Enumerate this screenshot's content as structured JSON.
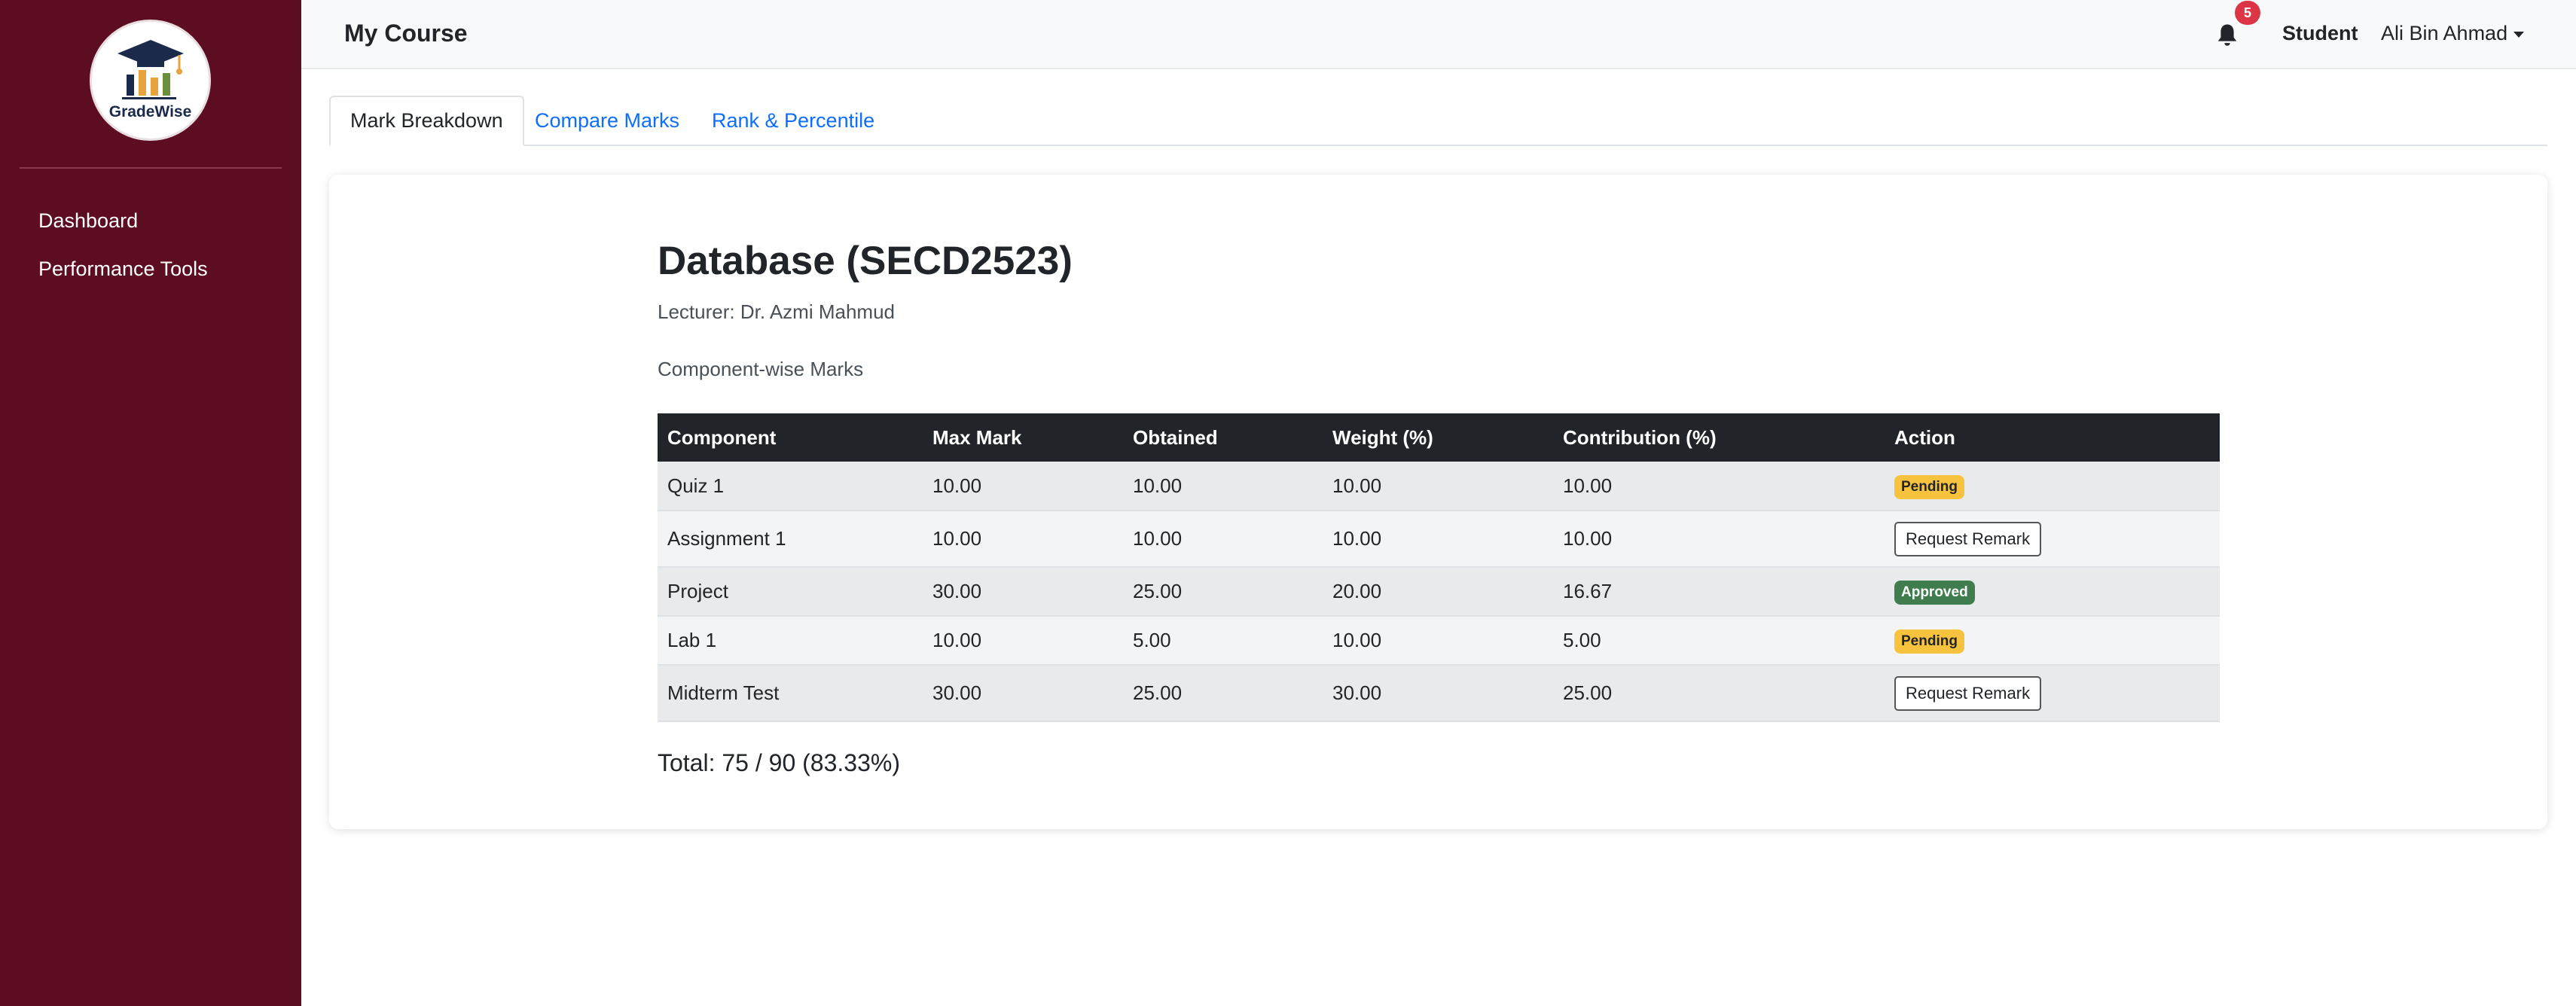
{
  "brand": {
    "logo_text": "GradeWise"
  },
  "sidebar": {
    "items": [
      {
        "label": "Dashboard"
      },
      {
        "label": "Performance Tools"
      }
    ]
  },
  "header": {
    "title": "My Course",
    "notification_count": "5",
    "role": "Student",
    "user_name": "Ali Bin Ahmad"
  },
  "tabs": [
    {
      "label": "Mark Breakdown",
      "active": true
    },
    {
      "label": "Compare Marks",
      "active": false
    },
    {
      "label": "Rank & Percentile",
      "active": false
    }
  ],
  "course": {
    "title": "Database (SECD2523)",
    "lecturer": "Lecturer: Dr. Azmi Mahmud",
    "section_label": "Component-wise Marks"
  },
  "table": {
    "headers": [
      "Component",
      "Max Mark",
      "Obtained",
      "Weight (%)",
      "Contribution (%)",
      "Action"
    ],
    "rows": [
      {
        "component": "Quiz 1",
        "max": "10.00",
        "obtained": "10.00",
        "weight": "10.00",
        "contribution": "10.00",
        "action": "Pending"
      },
      {
        "component": "Assignment 1",
        "max": "10.00",
        "obtained": "10.00",
        "weight": "10.00",
        "contribution": "10.00",
        "action": "Request Remark"
      },
      {
        "component": "Project",
        "max": "30.00",
        "obtained": "25.00",
        "weight": "20.00",
        "contribution": "16.67",
        "action": "Approved"
      },
      {
        "component": "Lab 1",
        "max": "10.00",
        "obtained": "5.00",
        "weight": "10.00",
        "contribution": "5.00",
        "action": "Pending"
      },
      {
        "component": "Midterm Test",
        "max": "30.00",
        "obtained": "25.00",
        "weight": "30.00",
        "contribution": "25.00",
        "action": "Request Remark"
      }
    ]
  },
  "total": "Total: 75 / 90 (83.33%)",
  "icons": {
    "logo": "graduation-cap-chart-icon",
    "bell": "bell-icon",
    "caret": "caret-down-icon"
  },
  "colors": {
    "sidebar": "#5c0d22",
    "pending": "#f7c23e",
    "approved": "#3f7d4f",
    "link": "#0d6efd",
    "badge": "#dc3545"
  }
}
